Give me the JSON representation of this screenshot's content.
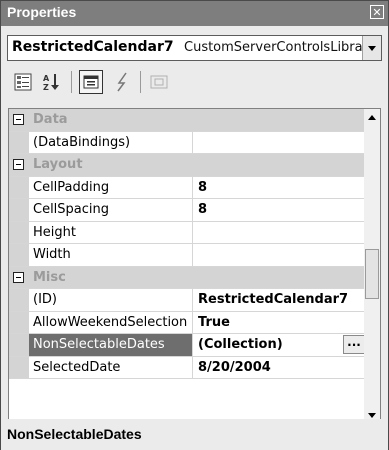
{
  "window": {
    "title": "Properties",
    "close_icon": "close-icon"
  },
  "object_selector": {
    "name": "RestrictedCalendar7",
    "type": "CustomServerControlsLibrary."
  },
  "toolbar": {
    "buttons": [
      {
        "icon": "categorized-icon",
        "active": false
      },
      {
        "icon": "alphabetical-sort-icon",
        "active": false
      },
      {
        "icon": "properties-icon",
        "active": true
      },
      {
        "icon": "events-lightning-icon",
        "active": false
      },
      {
        "icon": "property-pages-icon",
        "active": false
      }
    ]
  },
  "grid": {
    "categories": [
      {
        "label": "Data",
        "rows": [
          {
            "name": "(DataBindings)",
            "value": ""
          }
        ]
      },
      {
        "label": "Layout",
        "rows": [
          {
            "name": "CellPadding",
            "value": "8"
          },
          {
            "name": "CellSpacing",
            "value": "8"
          },
          {
            "name": "Height",
            "value": ""
          },
          {
            "name": "Width",
            "value": ""
          }
        ]
      },
      {
        "label": "Misc",
        "rows": [
          {
            "name": "(ID)",
            "value": "RestrictedCalendar7"
          },
          {
            "name": "AllowWeekendSelection",
            "value": "True"
          },
          {
            "name": "NonSelectableDates",
            "value": "(Collection)",
            "selected": true,
            "ellipsis": "..."
          },
          {
            "name": "SelectedDate",
            "value": "8/20/2004"
          }
        ]
      }
    ]
  },
  "description": {
    "title": "NonSelectableDates"
  },
  "colors": {
    "titlebar": "#7e7e7e",
    "selected_row": "#6e6e6e",
    "category_text": "#9b9b9b"
  }
}
